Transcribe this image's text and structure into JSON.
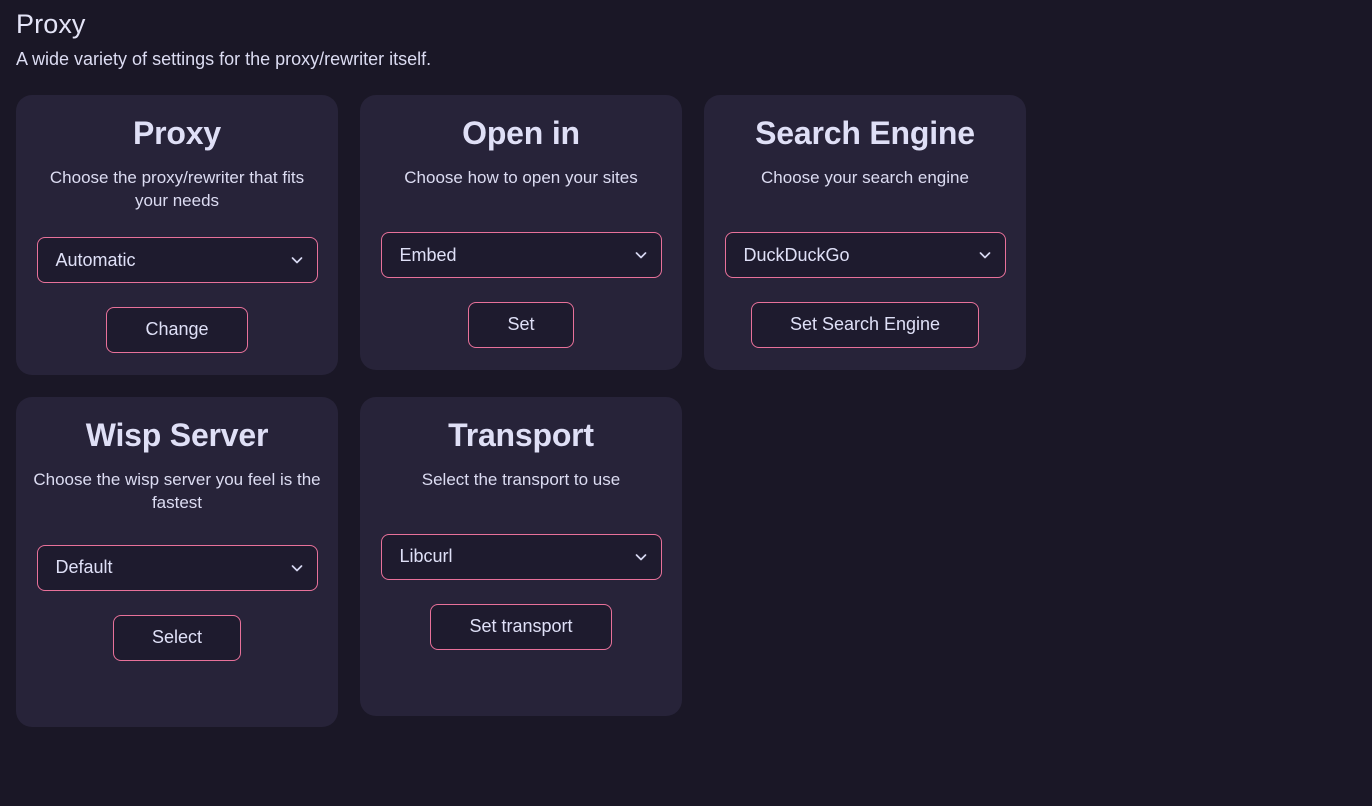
{
  "header": {
    "title": "Proxy",
    "subtitle": "A wide variety of settings for the proxy/rewriter itself."
  },
  "theme": {
    "page_background": "#1a1726",
    "card_background": "#272339",
    "control_background": "#1e1b2e",
    "accent_border": "#e8719a",
    "text_color": "#dcdcf5"
  },
  "cards": [
    {
      "title": "Proxy",
      "description": "Choose the proxy/rewriter that fits your needs",
      "select_value": "Automatic",
      "chevron_icon": "chevron-down-icon",
      "button_label": "Change"
    },
    {
      "title": "Open in",
      "description": "Choose how to open your sites",
      "select_value": "Embed",
      "chevron_icon": "chevron-down-icon",
      "button_label": "Set"
    },
    {
      "title": "Search Engine",
      "description": "Choose your search engine",
      "select_value": "DuckDuckGo",
      "chevron_icon": "chevron-down-icon",
      "button_label": "Set Search Engine"
    },
    {
      "title": "Wisp Server",
      "description": "Choose the wisp server you feel is the fastest",
      "select_value": "Default",
      "chevron_icon": "chevron-down-icon",
      "button_label": "Select"
    },
    {
      "title": "Transport",
      "description": "Select the transport to use",
      "select_value": "Libcurl",
      "chevron_icon": "chevron-down-icon",
      "button_label": "Set transport"
    }
  ]
}
